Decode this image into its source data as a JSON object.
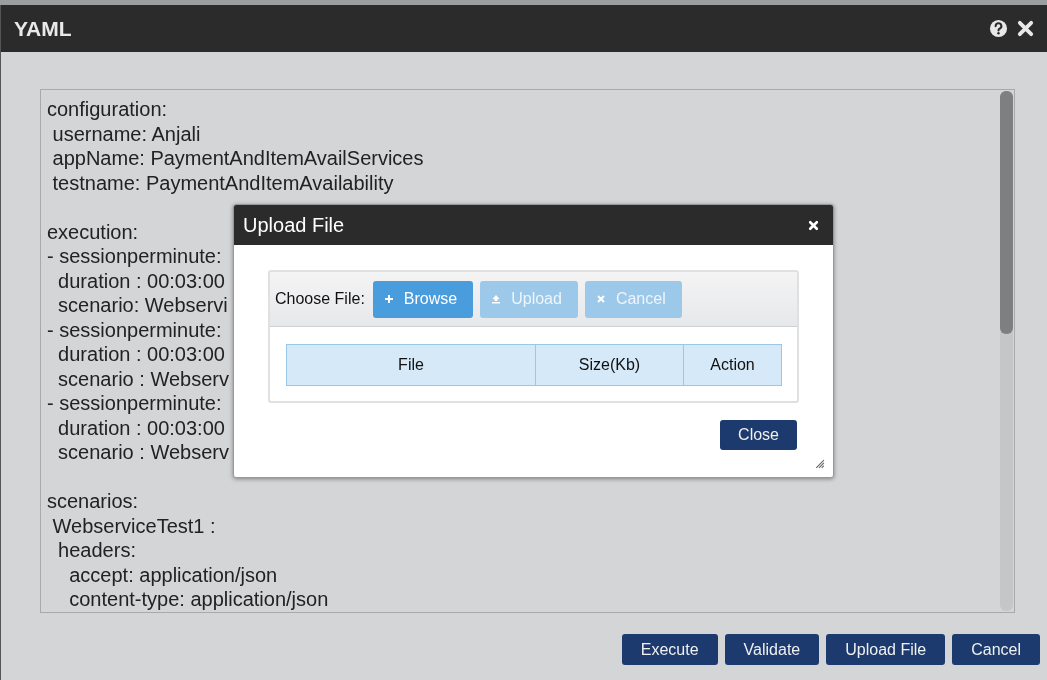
{
  "dialog": {
    "title": "YAML"
  },
  "editor": {
    "blocks": [
      [
        "configuration:",
        " username: Anjali",
        " appName: PaymentAndItemAvailServices",
        " testname: PaymentAndItemAvailability"
      ],
      [
        "execution:",
        "- sessionperminute:",
        "  duration : 00:03:00",
        "  scenario: Webservi",
        "- sessionperminute:",
        "  duration : 00:03:00",
        "  scenario : Webserv",
        "- sessionperminute:",
        "  duration : 00:03:00",
        "  scenario : Webserv"
      ],
      [
        "scenarios:",
        " WebserviceTest1 :",
        "  headers:",
        "    accept: application/json",
        "    content-type: application/json"
      ]
    ]
  },
  "upload_dialog": {
    "title": "Upload File",
    "choose_label": "Choose File:",
    "buttons": [
      {
        "label": "Browse",
        "kind": "browse",
        "disabled": false
      },
      {
        "label": "Upload",
        "kind": "upload",
        "disabled": true
      },
      {
        "label": "Cancel",
        "kind": "cancel",
        "disabled": true
      }
    ],
    "table": {
      "columns": [
        "File",
        "Size(Kb)",
        "Action"
      ]
    },
    "close_button": "Close"
  },
  "footer_buttons": [
    "Execute",
    "Validate",
    "Upload File",
    "Cancel"
  ]
}
